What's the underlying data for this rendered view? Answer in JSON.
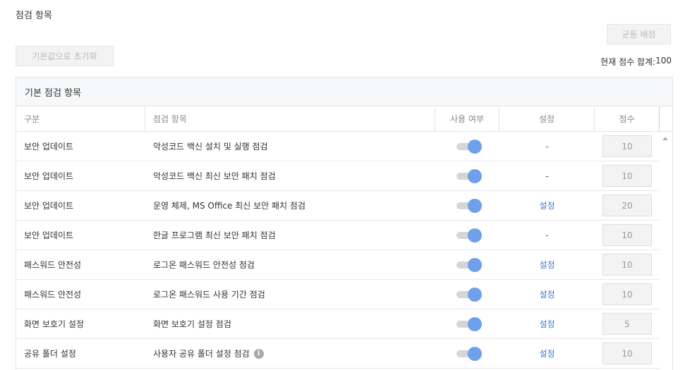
{
  "section_title": "점검 항목",
  "buttons": {
    "equal_distribution": "균등 배점",
    "reset_default": "기본값으로 초기화"
  },
  "total": {
    "label": "현재 점수 합계:",
    "value": "100"
  },
  "panel": {
    "title": "기본 점검 항목",
    "columns": {
      "category": "구분",
      "item": "점검 항목",
      "enabled": "사용 여부",
      "settings": "설정",
      "score": "점수"
    },
    "rows": [
      {
        "category": "보안 업데이트",
        "item": "악성코드 백신 설치 및 실행 점검",
        "enabled": true,
        "settings": "-",
        "settings_link": false,
        "score": "10",
        "info": false
      },
      {
        "category": "보안 업데이트",
        "item": "악성코드 백신 최신 보안 패치 점검",
        "enabled": true,
        "settings": "-",
        "settings_link": false,
        "score": "10",
        "info": false
      },
      {
        "category": "보안 업데이트",
        "item": "운영 체제, MS Office 최신 보안 패치 점검",
        "enabled": true,
        "settings": "설정",
        "settings_link": true,
        "score": "20",
        "info": false
      },
      {
        "category": "보안 업데이트",
        "item": "한글 프로그램 최신 보안 패치 점검",
        "enabled": true,
        "settings": "-",
        "settings_link": false,
        "score": "10",
        "info": false
      },
      {
        "category": "패스워드 안전성",
        "item": "로그온 패스워드 안전성 점검",
        "enabled": true,
        "settings": "설정",
        "settings_link": true,
        "score": "10",
        "info": false
      },
      {
        "category": "패스워드 안전성",
        "item": "로그온 패스워드 사용 기간 점검",
        "enabled": true,
        "settings": "설정",
        "settings_link": true,
        "score": "10",
        "info": false
      },
      {
        "category": "화면 보호기 설정",
        "item": "화면 보호기 설정 점검",
        "enabled": true,
        "settings": "설정",
        "settings_link": true,
        "score": "5",
        "info": false
      },
      {
        "category": "공유 폴더 설정",
        "item": "사용자 공유 폴더 설정 점검",
        "enabled": true,
        "settings": "설정",
        "settings_link": true,
        "score": "10",
        "info": true
      }
    ]
  },
  "icons": {
    "info": "info-circle-icon",
    "scroll_up": "scroll-up-arrow-icon"
  },
  "colors": {
    "toggle_on": "#6fa0eb",
    "link": "#3b76d6",
    "header_bg": "#f6f8f9"
  }
}
